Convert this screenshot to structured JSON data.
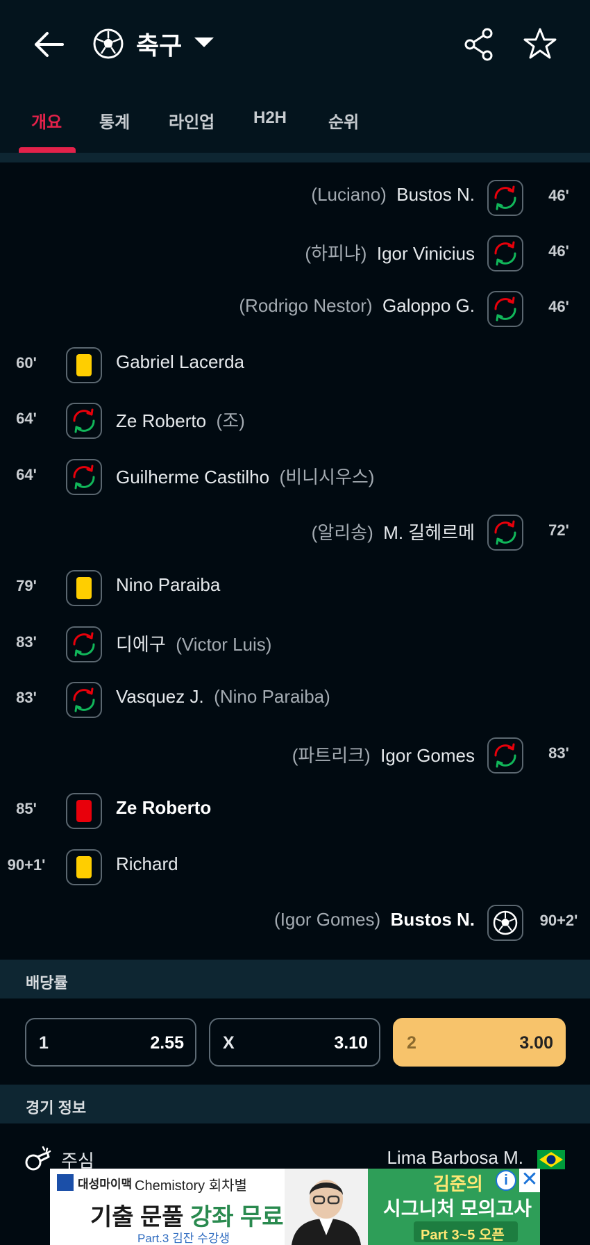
{
  "header": {
    "sport": "축구",
    "icons": [
      "back-arrow-icon",
      "soccer-ball-icon",
      "chevron-down-icon",
      "share-icon",
      "star-icon"
    ]
  },
  "tabs": [
    {
      "label": "개요",
      "active": true
    },
    {
      "label": "통계",
      "active": false
    },
    {
      "label": "라인업",
      "active": false
    },
    {
      "label": "H2H",
      "active": false
    },
    {
      "label": "순위",
      "active": false
    }
  ],
  "events": [
    {
      "side": "away",
      "time": "46'",
      "type": "substitution",
      "player": "Bustos N.",
      "detail": "(Luciano)"
    },
    {
      "side": "away",
      "time": "46'",
      "type": "substitution",
      "player": "Igor Vinicius",
      "detail": "(하피냐)"
    },
    {
      "side": "away",
      "time": "46'",
      "type": "substitution",
      "player": "Galoppo G.",
      "detail": "(Rodrigo Nestor)"
    },
    {
      "side": "home",
      "time": "60'",
      "type": "yellow-card",
      "player": "Gabriel Lacerda",
      "detail": ""
    },
    {
      "side": "home",
      "time": "64'",
      "type": "substitution",
      "player": "Ze Roberto",
      "detail": "(조)"
    },
    {
      "side": "home",
      "time": "64'",
      "type": "substitution",
      "player": "Guilherme Castilho",
      "detail": "(비니시우스)"
    },
    {
      "side": "away",
      "time": "72'",
      "type": "substitution",
      "player": "M. 길헤르메",
      "detail": "(알리송)"
    },
    {
      "side": "home",
      "time": "79'",
      "type": "yellow-card",
      "player": "Nino Paraiba",
      "detail": ""
    },
    {
      "side": "home",
      "time": "83'",
      "type": "substitution",
      "player": "디에구",
      "detail": "(Victor Luis)"
    },
    {
      "side": "home",
      "time": "83'",
      "type": "substitution",
      "player": "Vasquez J.",
      "detail": "(Nino Paraiba)"
    },
    {
      "side": "away",
      "time": "83'",
      "type": "substitution",
      "player": "Igor Gomes",
      "detail": "(파트리크)"
    },
    {
      "side": "home",
      "time": "85'",
      "type": "red-card",
      "player": "Ze Roberto",
      "detail": ""
    },
    {
      "side": "home",
      "time": "90+1'",
      "type": "yellow-card",
      "player": "Richard",
      "detail": ""
    },
    {
      "side": "away",
      "time": "90+2'",
      "type": "goal",
      "player": "Bustos N.",
      "detail": "(Igor Gomes)"
    }
  ],
  "odds": {
    "title": "배당률",
    "items": [
      {
        "label": "1",
        "value": "2.55",
        "highlight": false
      },
      {
        "label": "X",
        "value": "3.10",
        "highlight": false
      },
      {
        "label": "2",
        "value": "3.00",
        "highlight": true
      }
    ]
  },
  "match_info": {
    "title": "경기 정보",
    "referee_label": "주심",
    "referee_name": "Lima Barbosa M."
  },
  "ad": {
    "brand": "대성마이맥",
    "line1": "Chemistory 회차별",
    "line2a": "기출 문풀 ",
    "line2b": "강좌 무료",
    "line3": "Part.3 김잔 수강생",
    "right1": "김준의",
    "right2": "시그니처 모의고사",
    "right3": "Part 3~5 오픈"
  },
  "colors": {
    "accent": "#e3224a",
    "yellow_card": "#ffce00",
    "red_card": "#e8000b",
    "odds_highlight": "#f7c36b"
  }
}
